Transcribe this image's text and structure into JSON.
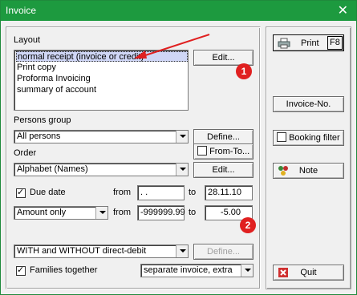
{
  "window": {
    "title": "Invoice",
    "close_glyph": "✕"
  },
  "layout": {
    "label": "Layout",
    "items": [
      "normal receipt (invoice or credit)",
      "Print copy",
      "Proforma Invoicing",
      "summary of account"
    ],
    "edit_button": "Edit..."
  },
  "persons_group": {
    "label": "Persons group",
    "value": "All persons",
    "define_button": "Define..."
  },
  "from_to": {
    "label": "From-To..."
  },
  "order": {
    "label": "Order",
    "value": "Alphabet (Names)",
    "edit_button": "Edit..."
  },
  "due_date": {
    "label": "Due date",
    "from_label": "from",
    "from_value": " .  .",
    "to_label": "to",
    "to_value": "28.11.10"
  },
  "amount": {
    "mode": "Amount only",
    "from_label": "from",
    "from_value": "-999999.99",
    "to_label": "to",
    "to_value": "-5.00"
  },
  "direct_debit": {
    "value": "WITH and WITHOUT direct-debit",
    "define_button": "Define..."
  },
  "families": {
    "label": "Families together",
    "value": "separate invoice, extra"
  },
  "right": {
    "print_button": "Print",
    "print_key": "F8",
    "invoice_no_button": "Invoice-No.",
    "booking_filter_label": "Booking filter",
    "note_button": "Note",
    "quit_button": "Quit"
  },
  "annotations": {
    "badge1": "1",
    "badge2": "2",
    "arrow_color": "#e02020"
  },
  "colors": {
    "titlebar": "#1d9a3f",
    "selection": "#cfd6f5"
  }
}
